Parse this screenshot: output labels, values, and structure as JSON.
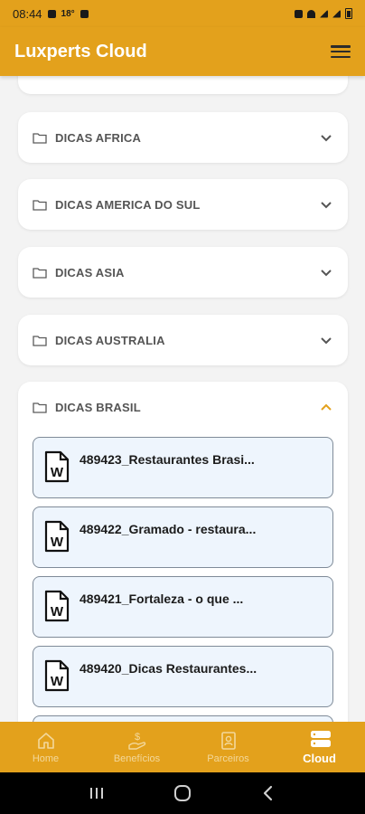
{
  "status_bar": {
    "time": "08:44",
    "temperature": "18°",
    "icons": [
      "notification-icon",
      "image-icon",
      "alarm-icon",
      "wifi-icon",
      "signal-icon",
      "battery-icon"
    ]
  },
  "app_bar": {
    "title": "Luxperts Cloud",
    "menu_icon": "hamburger-menu-icon"
  },
  "folders": [
    {
      "label": "DICAS AFRICA",
      "expanded": false
    },
    {
      "label": "DICAS AMERICA DO SUL",
      "expanded": false
    },
    {
      "label": "DICAS ASIA",
      "expanded": false
    },
    {
      "label": "DICAS AUSTRALIA",
      "expanded": false
    },
    {
      "label": "DICAS BRASIL",
      "expanded": true
    }
  ],
  "files": [
    {
      "name": "489423_Restaurantes Brasi...",
      "icon": "word-document-icon"
    },
    {
      "name": "489422_Gramado - restaura...",
      "icon": "word-document-icon"
    },
    {
      "name": "489421_Fortaleza - o que ...",
      "icon": "word-document-icon"
    },
    {
      "name": "489420_Dicas Restaurantes...",
      "icon": "word-document-icon"
    }
  ],
  "bottom_nav": {
    "items": [
      {
        "label": "Home",
        "icon": "home-icon",
        "active": false
      },
      {
        "label": "Benefícios",
        "icon": "benefits-icon",
        "active": false
      },
      {
        "label": "Parceiros",
        "icon": "partners-icon",
        "active": false
      },
      {
        "label": "Cloud",
        "icon": "cloud-server-icon",
        "active": true
      }
    ]
  },
  "colors": {
    "accent": "#e3a11c",
    "chevron_active": "#e3a11c",
    "file_bg": "#eef5fd",
    "background": "#f3f3f3"
  }
}
